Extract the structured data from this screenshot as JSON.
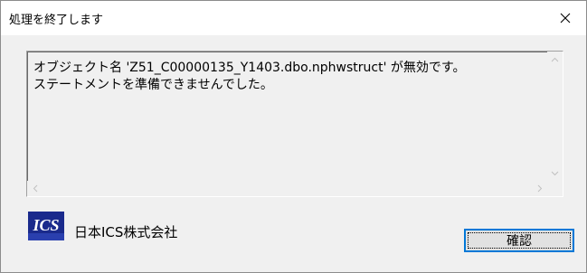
{
  "window": {
    "title": "処理を終了します",
    "close_icon": "close-icon"
  },
  "message": {
    "line1": "オブジェクト名 'Z51_C00000135_Y1403.dbo.nphwstruct' が無効です。",
    "line2": "ステートメントを準備できませんでした。"
  },
  "footer": {
    "logo_text": "ICS",
    "company_name": "日本ICS株式会社",
    "ok_label": "確認"
  },
  "colors": {
    "focus_border": "#0078d7",
    "logo_blue": "#1a2a8c"
  }
}
